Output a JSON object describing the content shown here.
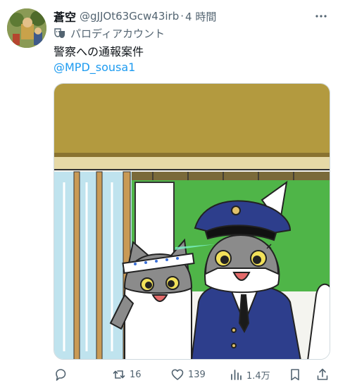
{
  "author": {
    "display_name": "蒼空",
    "handle": "@gJJOt63Gcw43irb",
    "separator": "·",
    "time": "4 時間",
    "label": "パロディアカウント"
  },
  "tweet": {
    "text": "警察への通報案件",
    "mention": "@MPD_sousa1"
  },
  "stats": {
    "replies": "",
    "retweets": "16",
    "likes": "139",
    "views": "1.4万"
  },
  "icons": {
    "more": "more-icon",
    "parody": "parody-mask-icon",
    "reply": "reply-icon",
    "retweet": "retweet-icon",
    "like": "heart-icon",
    "views": "views-icon",
    "bookmark": "bookmark-icon",
    "share": "share-icon"
  },
  "colors": {
    "link": "#1d9bf0",
    "secondary_text": "#536471",
    "primary_text": "#0f1419"
  }
}
